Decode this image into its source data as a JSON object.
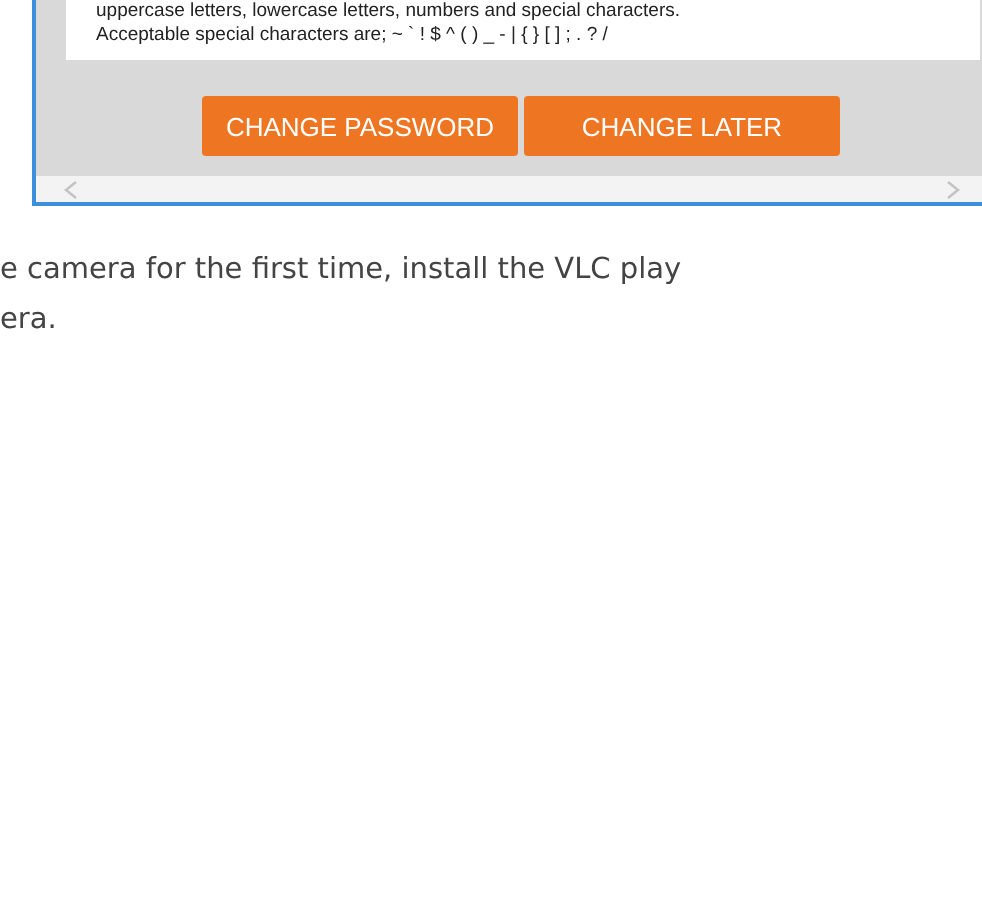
{
  "notice": {
    "lines": [
      "uppercase letters, lowercase letters, numbers and special characters.",
      "Acceptable special characters are; ~ ` ! $ ^ ( ) _ - | { } [ ] ; . ? /"
    ]
  },
  "buttons": [
    {
      "label": "CHANGE PASSWORD"
    },
    {
      "label": "CHANGE LATER"
    }
  ],
  "paragraph_lines": [
    "e camera for the first time, install the VLC play",
    "era."
  ]
}
